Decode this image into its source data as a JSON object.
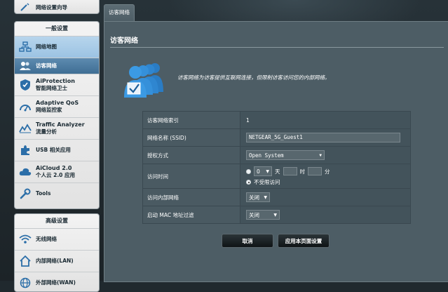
{
  "sidebar": {
    "top_item": "网络设置向导",
    "general_header": "一般设置",
    "general_items": [
      {
        "key": "network-map",
        "line1": "网络地图",
        "line2": "",
        "icon": "network-map-icon"
      },
      {
        "key": "guest-network",
        "line1": "访客网络",
        "line2": "",
        "icon": "guest-network-icon"
      },
      {
        "key": "aiprotection",
        "line1": "AiProtection",
        "line2": "智能网络卫士",
        "icon": "shield-icon"
      },
      {
        "key": "adaptive-qos",
        "line1": "Adaptive QoS",
        "line2": "网络监控家",
        "icon": "gauge-icon"
      },
      {
        "key": "traffic-analyzer",
        "line1": "Traffic Analyzer",
        "line2": "流量分析",
        "icon": "chart-line-icon"
      },
      {
        "key": "usb-apps",
        "line1": "USB 相关应用",
        "line2": "",
        "icon": "puzzle-icon"
      },
      {
        "key": "aicloud",
        "line1": "AiCloud 2.0",
        "line2": "个人云 2.0 应用",
        "icon": "cloud-icon"
      },
      {
        "key": "tools",
        "line1": "Tools",
        "line2": "",
        "icon": "wrench-icon"
      }
    ],
    "advanced_header": "高级设置",
    "advanced_items": [
      {
        "key": "wireless",
        "line1": "无线网络",
        "icon": "wifi-icon"
      },
      {
        "key": "lan",
        "line1": "内部网络(LAN)",
        "icon": "home-icon"
      },
      {
        "key": "wan",
        "line1": "外部网络(WAN)",
        "icon": "globe-icon"
      }
    ]
  },
  "tab": {
    "label": "访客网络"
  },
  "page": {
    "title": "访客网络",
    "description": "访客网络为访客提供互联网连接，但限制访客访问您的内部网络。"
  },
  "form": {
    "index": {
      "label": "访客网络索引",
      "value": "1"
    },
    "ssid": {
      "label": "网络名称 (SSID)",
      "value": "NETGEAR_5G_Guest1"
    },
    "auth": {
      "label": "授权方式",
      "value": "Open System"
    },
    "access_time": {
      "label": "访问时间",
      "day_value": "0",
      "day_unit": "天",
      "hour_unit": "时",
      "minute_unit": "分",
      "unlimited_label": "不受限访问"
    },
    "intranet": {
      "label": "访问内部网络",
      "value": "关闭"
    },
    "mac_filter": {
      "label": "启动 MAC 地址过滤",
      "value": "关闭"
    }
  },
  "buttons": {
    "cancel": "取消",
    "apply": "应用本页面设置"
  },
  "colors": {
    "panel": "#4d5d65",
    "sidebar": "#f3f3f3",
    "active": "#4a7aa0",
    "accent_icon": "#2e7fc8"
  }
}
